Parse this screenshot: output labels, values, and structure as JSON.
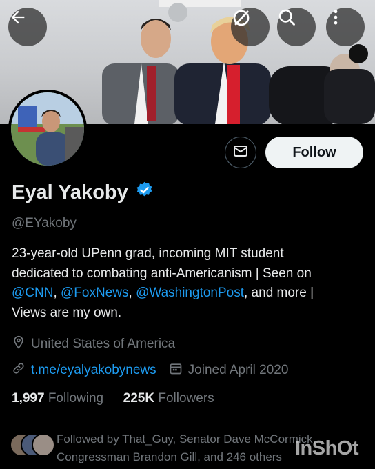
{
  "header": {
    "back_icon": "arrow-left-icon",
    "grok_icon": "grok-icon",
    "search_icon": "search-icon",
    "more_icon": "more-vertical-icon"
  },
  "profile": {
    "name": "Eyal Yakoby",
    "handle": "@EYakoby",
    "verified": true,
    "follow_label": "Follow",
    "bio": {
      "line1": "23-year-old UPenn grad, incoming MIT student",
      "line2": "dedicated to combating anti-Americanism | Seen on",
      "mention1": "@CNN",
      "sep1": ", ",
      "mention2": "@FoxNews",
      "sep2": ", ",
      "mention3": "@WashingtonPost",
      "tail": ", and more |",
      "line4": "Views are my own."
    },
    "location": "United States of America",
    "website": "t.me/eyalyakobynews",
    "joined": "Joined April 2020",
    "following_count": "1,997",
    "following_label": "Following",
    "followers_count": "225K",
    "followers_label": "Followers",
    "followed_by": "Followed by That_Guy, Senator Dave McCormick, Congressman Brandon Gill, and 246 others"
  },
  "watermark": "InShOt",
  "colors": {
    "background": "#000000",
    "link": "#1d9bf0",
    "muted": "#71767b",
    "text": "#e7e9ea",
    "follow_bg": "#eff3f4"
  }
}
